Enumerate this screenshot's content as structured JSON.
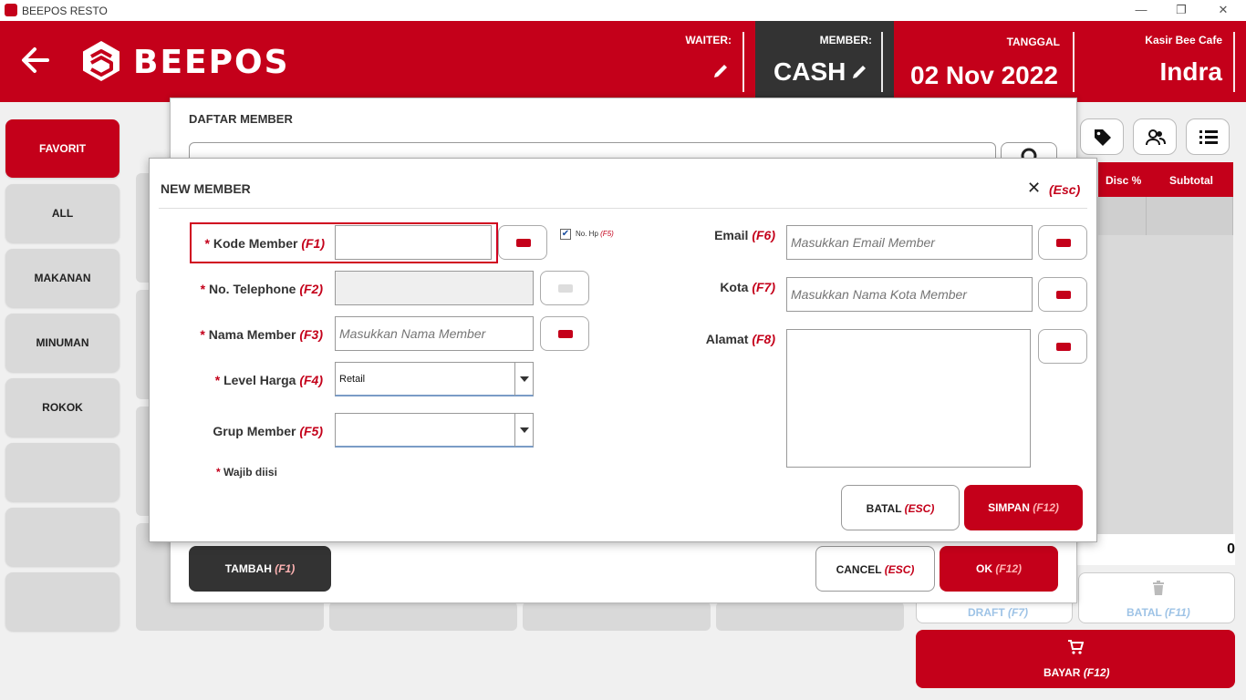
{
  "window": {
    "title": "BEEPOS RESTO",
    "min": "—",
    "restore": "❐",
    "close": "✕"
  },
  "header": {
    "brand": "BEEPOS",
    "waiter_label": "WAITER:",
    "member_label": "MEMBER:",
    "member_value": "CASH",
    "date_label": "TANGGAL",
    "date_value": "02 Nov 2022",
    "cashier_label": "Kasir Bee Cafe",
    "cashier_name": "Indra",
    "colors": {
      "brand": "#c4001a",
      "member_bg": "#333333"
    }
  },
  "sidebar": {
    "items": [
      {
        "label": "FAVORIT",
        "active": true
      },
      {
        "label": "ALL"
      },
      {
        "label": "MAKANAN"
      },
      {
        "label": "MINUMAN"
      },
      {
        "label": "ROKOK"
      },
      {
        "label": ""
      },
      {
        "label": ""
      },
      {
        "label": ""
      }
    ]
  },
  "cart": {
    "headers": [
      "Disc %",
      "Subtotal"
    ],
    "total": "0",
    "draft": {
      "label": "DRAFT",
      "key": "(F7)"
    },
    "batal": {
      "label": "BATAL",
      "key": "(F11)"
    },
    "bayar": {
      "label": "BAYAR",
      "key": "(F12)"
    },
    "icons": [
      "tag-icon",
      "people-icon",
      "list-icon"
    ]
  },
  "daftar_member": {
    "title": "DAFTAR MEMBER",
    "tambah": {
      "label": "TAMBAH",
      "key": "(F1)"
    },
    "cancel": {
      "label": "CANCEL",
      "key": "(ESC)"
    },
    "ok": {
      "label": "OK",
      "key": "(F12)"
    }
  },
  "new_member": {
    "title": "NEW MEMBER",
    "close_key": "(Esc)",
    "required_note": "Wajib diisi",
    "nohp_label": "No. Hp",
    "nohp_key": "(F5)",
    "nohp_checked": true,
    "fields": {
      "kode": {
        "label": "Kode Member",
        "key": "(F1)",
        "value": "",
        "required": true
      },
      "telp": {
        "label": "No. Telephone",
        "key": "(F2)",
        "value": "",
        "required": true
      },
      "nama": {
        "label": "Nama Member",
        "key": "(F3)",
        "placeholder": "Masukkan Nama Member",
        "required": true
      },
      "level": {
        "label": "Level Harga",
        "key": "(F4)",
        "value": "Retail",
        "required": true
      },
      "grup": {
        "label": "Grup Member",
        "key": "(F5)",
        "value": ""
      },
      "email": {
        "label": "Email",
        "key": "(F6)",
        "placeholder": "Masukkan Email Member"
      },
      "kota": {
        "label": "Kota",
        "key": "(F7)",
        "placeholder": "Masukkan Nama Kota Member"
      },
      "alamat": {
        "label": "Alamat",
        "key": "(F8)",
        "value": ""
      }
    },
    "batal": {
      "label": "BATAL",
      "key": "(ESC)"
    },
    "simpan": {
      "label": "SIMPAN",
      "key": "(F12)"
    }
  }
}
